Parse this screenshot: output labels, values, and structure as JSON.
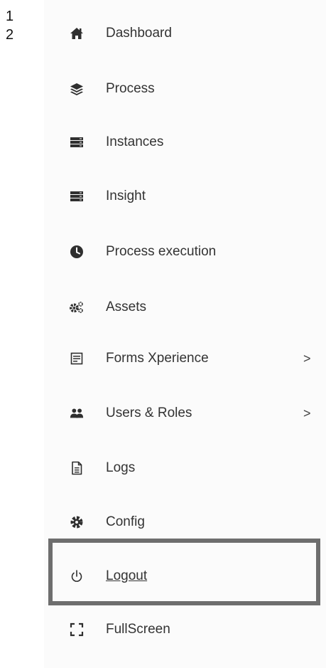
{
  "line_numbers": [
    "1",
    "2"
  ],
  "menu": {
    "items": [
      {
        "label": "Dashboard",
        "icon": "home-icon"
      },
      {
        "label": "Process",
        "icon": "layers-icon"
      },
      {
        "label": "Instances",
        "icon": "server-icon"
      },
      {
        "label": "Insight",
        "icon": "server-icon"
      },
      {
        "label": "Process execution",
        "icon": "clock-icon"
      },
      {
        "label": "Assets",
        "icon": "cogs-icon"
      },
      {
        "label": "Forms Xperience",
        "icon": "form-icon",
        "chevron": ">"
      },
      {
        "label": "Users & Roles",
        "icon": "users-icon",
        "chevron": ">"
      },
      {
        "label": "Logs",
        "icon": "file-icon"
      },
      {
        "label": "Config",
        "icon": "gear-icon"
      },
      {
        "label": "Logout",
        "icon": "power-icon"
      },
      {
        "label": "FullScreen",
        "icon": "fullscreen-icon"
      }
    ]
  },
  "highlight_color": "#6e6e6e"
}
